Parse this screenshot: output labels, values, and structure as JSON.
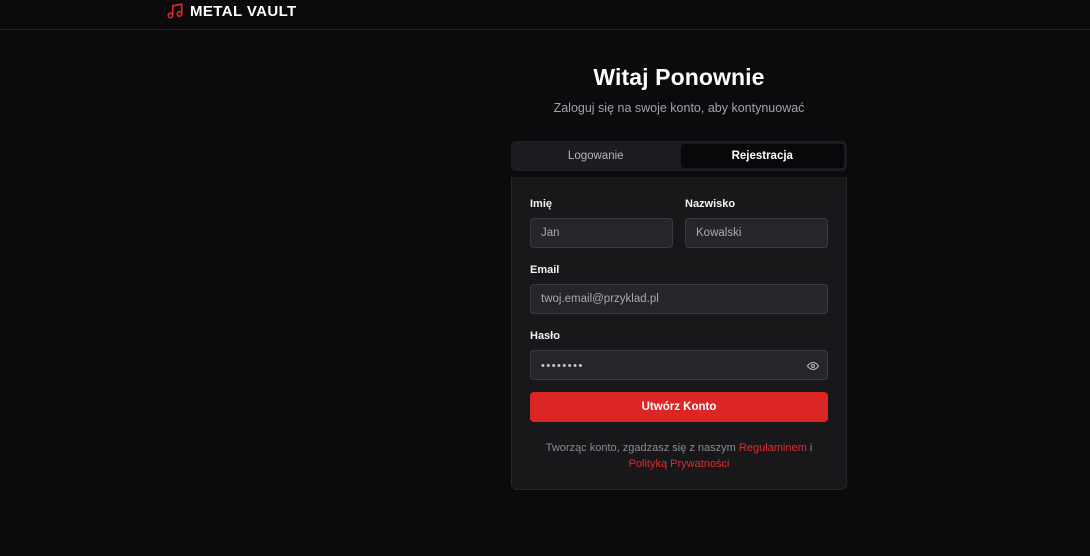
{
  "brand": {
    "name": "METAL VAULT",
    "icon": "music-note-icon",
    "accent": "#dc2626"
  },
  "header": {
    "title": "Witaj Ponownie",
    "subtitle": "Zaloguj się na swoje konto, aby kontynuować"
  },
  "tabs": [
    {
      "label": "Logowanie",
      "active": false
    },
    {
      "label": "Rejestracja",
      "active": true
    }
  ],
  "form": {
    "first_name": {
      "label": "Imię",
      "placeholder": "Jan"
    },
    "last_name": {
      "label": "Nazwisko",
      "placeholder": "Kowalski"
    },
    "email": {
      "label": "Email",
      "placeholder": "twoj.email@przyklad.pl"
    },
    "password": {
      "label": "Hasło",
      "masked": "••••••••",
      "toggle_icon": "eye-icon"
    },
    "submit_label": "Utwórz Konto",
    "terms": {
      "prefix": "Tworząc konto, zgadzasz się z naszym",
      "terms_link": "Regulaminem",
      "joiner": "i",
      "privacy_link": "Polityką Prywatności"
    }
  }
}
